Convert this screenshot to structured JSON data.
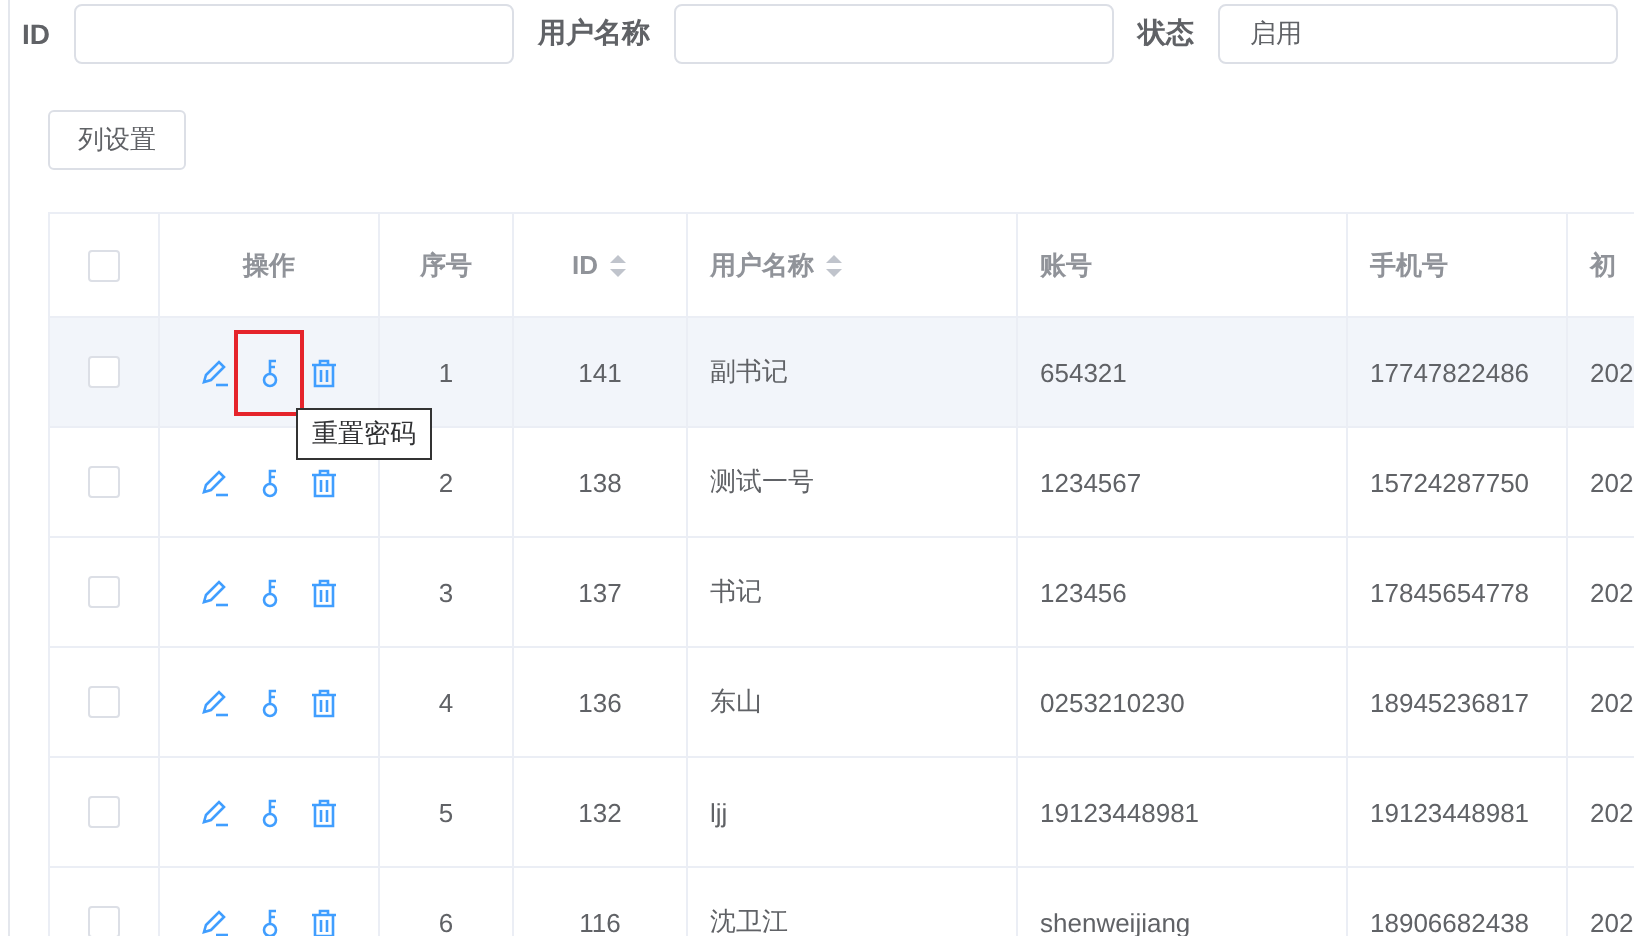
{
  "filters": [
    {
      "label": "ID",
      "kind": "text"
    },
    {
      "label": "用户名称",
      "kind": "text"
    },
    {
      "label": "状态",
      "kind": "select",
      "value": "启用"
    }
  ],
  "column_settings_button": "列设置",
  "table": {
    "select_all_checked": false,
    "columns": [
      {
        "label": "操作",
        "kind": "actions",
        "sortable": false
      },
      {
        "label": "序号",
        "kind": "center",
        "sortable": false
      },
      {
        "label": "ID",
        "kind": "center",
        "sortable": true
      },
      {
        "label": "用户名称",
        "kind": "text",
        "sortable": true
      },
      {
        "label": "账号",
        "kind": "text",
        "sortable": false
      },
      {
        "label": "手机号",
        "kind": "text",
        "sortable": false
      },
      {
        "label": "初",
        "kind": "text",
        "sortable": false
      }
    ],
    "rows": [
      {
        "checked": false,
        "highlighted": true,
        "marked": true,
        "tooltip": "重置密码",
        "cells": [
          "",
          "1",
          "141",
          "副书记",
          "654321",
          "17747822486",
          "202"
        ]
      },
      {
        "checked": false,
        "highlighted": false,
        "marked": false,
        "cells": [
          "",
          "2",
          "138",
          "测试一号",
          "1234567",
          "15724287750",
          "202"
        ]
      },
      {
        "checked": false,
        "highlighted": false,
        "marked": false,
        "cells": [
          "",
          "3",
          "137",
          "书记",
          "123456",
          "17845654778",
          "202"
        ]
      },
      {
        "checked": false,
        "highlighted": false,
        "marked": false,
        "cells": [
          "",
          "4",
          "136",
          "东山",
          "0253210230",
          "18945236817",
          "202"
        ]
      },
      {
        "checked": false,
        "highlighted": false,
        "marked": false,
        "cells": [
          "",
          "5",
          "132",
          "ljj",
          "19123448981",
          "19123448981",
          "202"
        ]
      },
      {
        "checked": false,
        "highlighted": false,
        "marked": false,
        "cells": [
          "",
          "6",
          "116",
          "沈卫江",
          "shenweijiang",
          "18906682438",
          "202"
        ]
      }
    ]
  }
}
